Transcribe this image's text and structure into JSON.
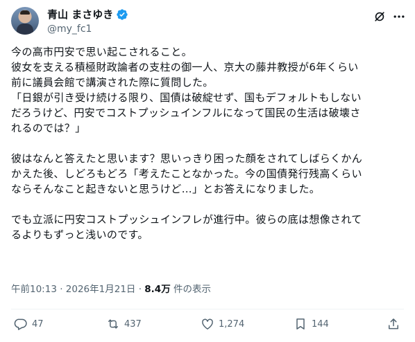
{
  "author": {
    "display_name": "青山 まさゆき",
    "handle": "@my_fc1",
    "verified": true,
    "avatar_icon": "avatar"
  },
  "header_icons": [
    "grok-icon",
    "more-icon"
  ],
  "tweet": {
    "lines": [
      "今の高市円安で思い起こされること。",
      "彼女を支える積極財政論者の支柱の御一人、京大の藤井教授が6年くらい",
      "前に議員会館で講演された際に質問した。",
      "「日銀が引き受け続ける限り、国債は破綻せず、国もデフォルトもしない",
      "だろうけど、円安でコストプッシュインフルになって国民の生活は破壊さ",
      "れるのでは？」",
      "",
      "彼はなんと答えたと思います？思いっきり困った顔をされてしばらくかん",
      "かえた後、しどろもどろ「考えたことなかった。今の国債発行残高くらい",
      "ならそんなこと起きないと思うけど…」とお答えになりました。",
      "",
      "でも立派に円安コストプッシュインフレが進行中。彼らの底は想像されて",
      "るよりもずっと浅いのです。"
    ]
  },
  "meta": {
    "time": "午前10:13",
    "separator": " · ",
    "date": "2026年1月21日",
    "views": "8.4万",
    "views_label": " 件の表示"
  },
  "actions": {
    "replies": "47",
    "reposts": "437",
    "likes": "1,274",
    "bookmarks": "144"
  },
  "colors": {
    "text": "#0f1419",
    "secondary": "#536471",
    "verified": "#1d9bf0",
    "divider": "#eff3f4"
  }
}
